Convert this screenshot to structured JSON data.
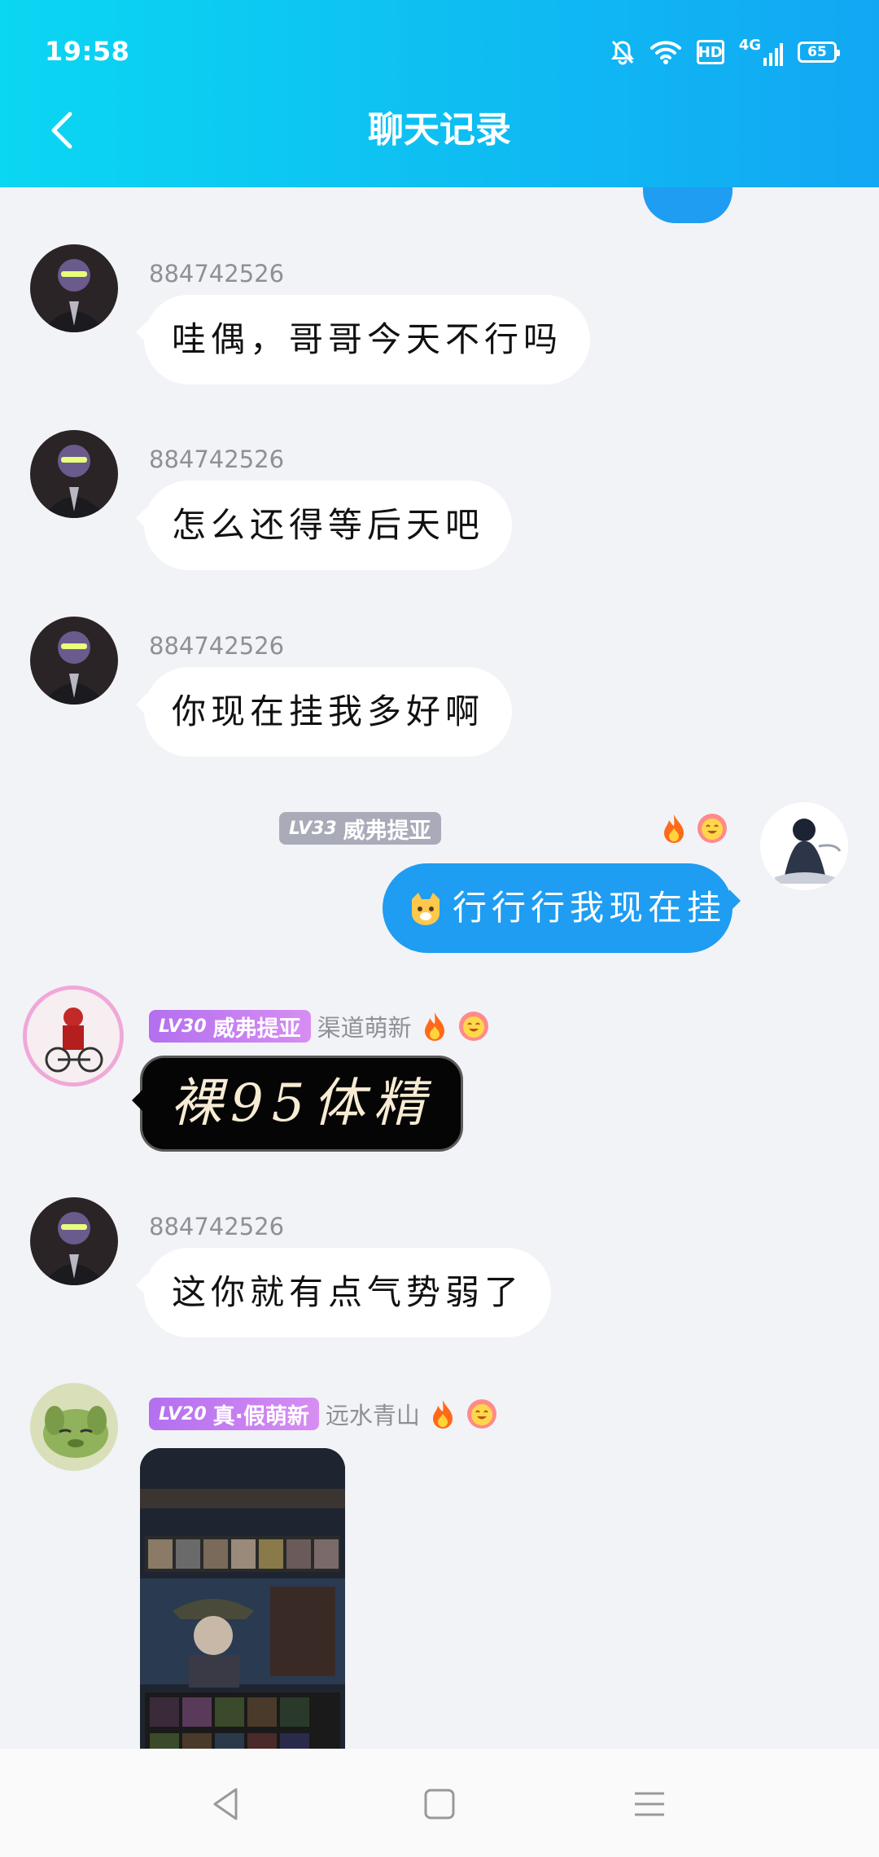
{
  "status_bar": {
    "time": "19:58",
    "hd": "HD",
    "network": "4G",
    "battery": "65"
  },
  "header": {
    "title": "聊天记录"
  },
  "messages": [
    {
      "sender": "884742526",
      "text": "哇偶，哥哥今天不行吗"
    },
    {
      "sender": "884742526",
      "text": "怎么还得等后天吧"
    },
    {
      "sender": "884742526",
      "text": "你现在挂我多好啊"
    },
    {
      "level": "LV33",
      "title": "威弗提亚",
      "text": "行行行我现在挂"
    },
    {
      "level": "LV30",
      "title": "威弗提亚",
      "name": "渠道萌新",
      "text": "裸95体精"
    },
    {
      "sender": "884742526",
      "text": "这你就有点气势弱了"
    },
    {
      "level": "LV20",
      "title": "真·假萌新",
      "name": "远水青山",
      "image_alt": "游戏截图 角色"
    }
  ],
  "colors": {
    "header_start": "#0ad7f2",
    "header_end": "#12a7f3",
    "my_bubble": "#1e9df2",
    "background": "#f2f3f7"
  },
  "icons": [
    "back-arrow-icon",
    "bell-off-icon",
    "wifi-icon",
    "signal-icon",
    "fire-icon",
    "smiley-badge-icon",
    "back-nav-icon",
    "home-nav-icon",
    "menu-nav-icon"
  ]
}
